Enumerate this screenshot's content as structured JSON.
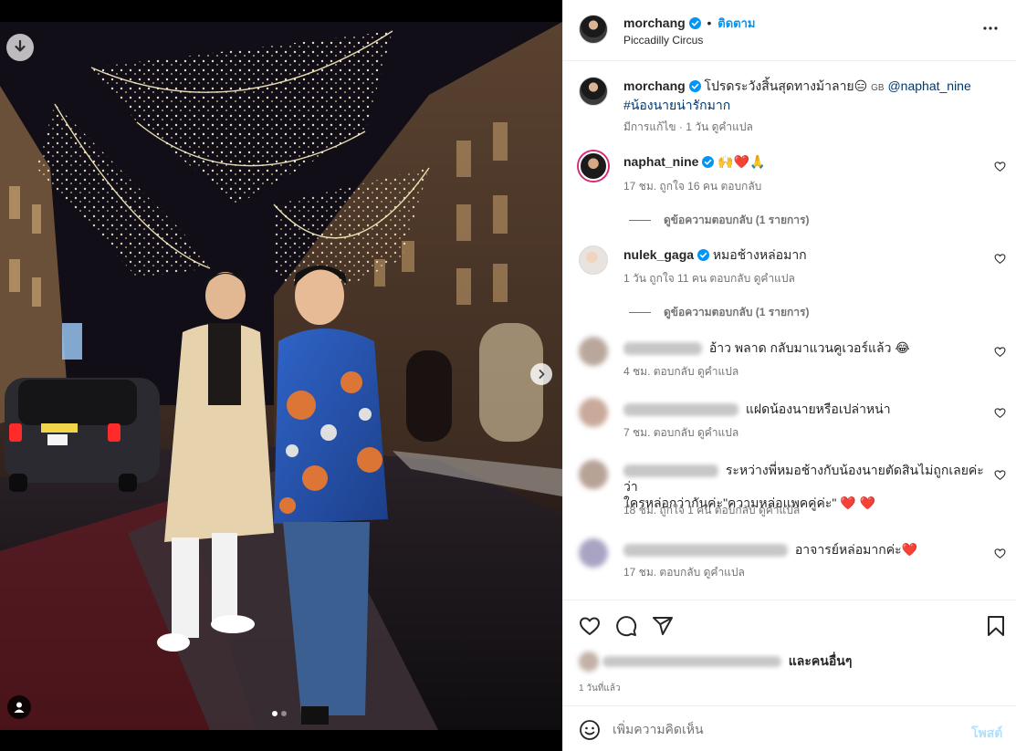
{
  "header": {
    "username": "morchang",
    "follow_label": "ติดตาม",
    "separator": "•",
    "location": "Piccadilly Circus"
  },
  "caption": {
    "username": "morchang",
    "text": "โปรดระวังสิ้นสุดทางม้าลาย😑",
    "flag": "GB",
    "mention": "@naphat_nine",
    "hashtag": "#น้องนายน่ารักมาก",
    "edited": "มีการแก้ไข · 1 วัน",
    "translate": "ดูคำแปล"
  },
  "comments": [
    {
      "username": "naphat_nine",
      "verified": true,
      "text": "🙌❤️🙏",
      "time": "17 ชม.",
      "likes": "ถูกใจ 16 คน",
      "reply": "ตอบกลับ",
      "view_replies": "ดูข้อความตอบกลับ (1 รายการ)"
    },
    {
      "username": "nulek_gaga",
      "verified": true,
      "text": "หมอช้างหล่อมาก",
      "time": "1 วัน",
      "likes": "ถูกใจ 11 คน",
      "reply": "ตอบกลับ",
      "translate": "ดูคำแปล",
      "view_replies": "ดูข้อความตอบกลับ (1 รายการ)"
    },
    {
      "text": "อ้าว พลาด กลับมาแวนคูเวอร์แล้ว 😂",
      "time": "4 ชม.",
      "reply": "ตอบกลับ",
      "translate": "ดูคำแปล"
    },
    {
      "text": "แฝดน้องนายหรือเปล่าหน่า",
      "time": "7 ชม.",
      "reply": "ตอบกลับ",
      "translate": "ดูคำแปล"
    },
    {
      "text_line1": "ระหว่างพี่หมอช้างกับน้องนายตัดสินไม่ถูกเลยค่ะว่า",
      "text_line2": "ใครหล่อกว่ากันค่ะ\"ความหล่อแพคคู่ค่ะ\" ❤️ ❤️",
      "time": "18 ชม.",
      "likes": "ถูกใจ 1 คน",
      "reply": "ตอบกลับ",
      "translate": "ดูคำแปล"
    },
    {
      "text": "อาจารย์หล่อมากค่ะ❤️",
      "time": "17 ชม.",
      "reply": "ตอบกลับ",
      "translate": "ดูคำแปล"
    }
  ],
  "likes_line": {
    "suffix": "และคนอื่นๆ"
  },
  "post_time": "1 วันที่แล้ว",
  "composer": {
    "placeholder": "เพิ่มความคิดเห็น",
    "post_label": "โพสต์"
  },
  "colors": {
    "accent": "#0095f6",
    "verified": "#0095f6",
    "heart_red": "#ed4956",
    "story_ring": "#d62976"
  },
  "icons": [
    "download-icon",
    "chevron-right-icon",
    "user-tag-icon",
    "verified-badge-icon",
    "more-options-icon",
    "heart-icon",
    "comment-icon",
    "share-icon",
    "bookmark-icon",
    "emoji-icon"
  ],
  "carousel": {
    "total": 2,
    "current": 1
  }
}
